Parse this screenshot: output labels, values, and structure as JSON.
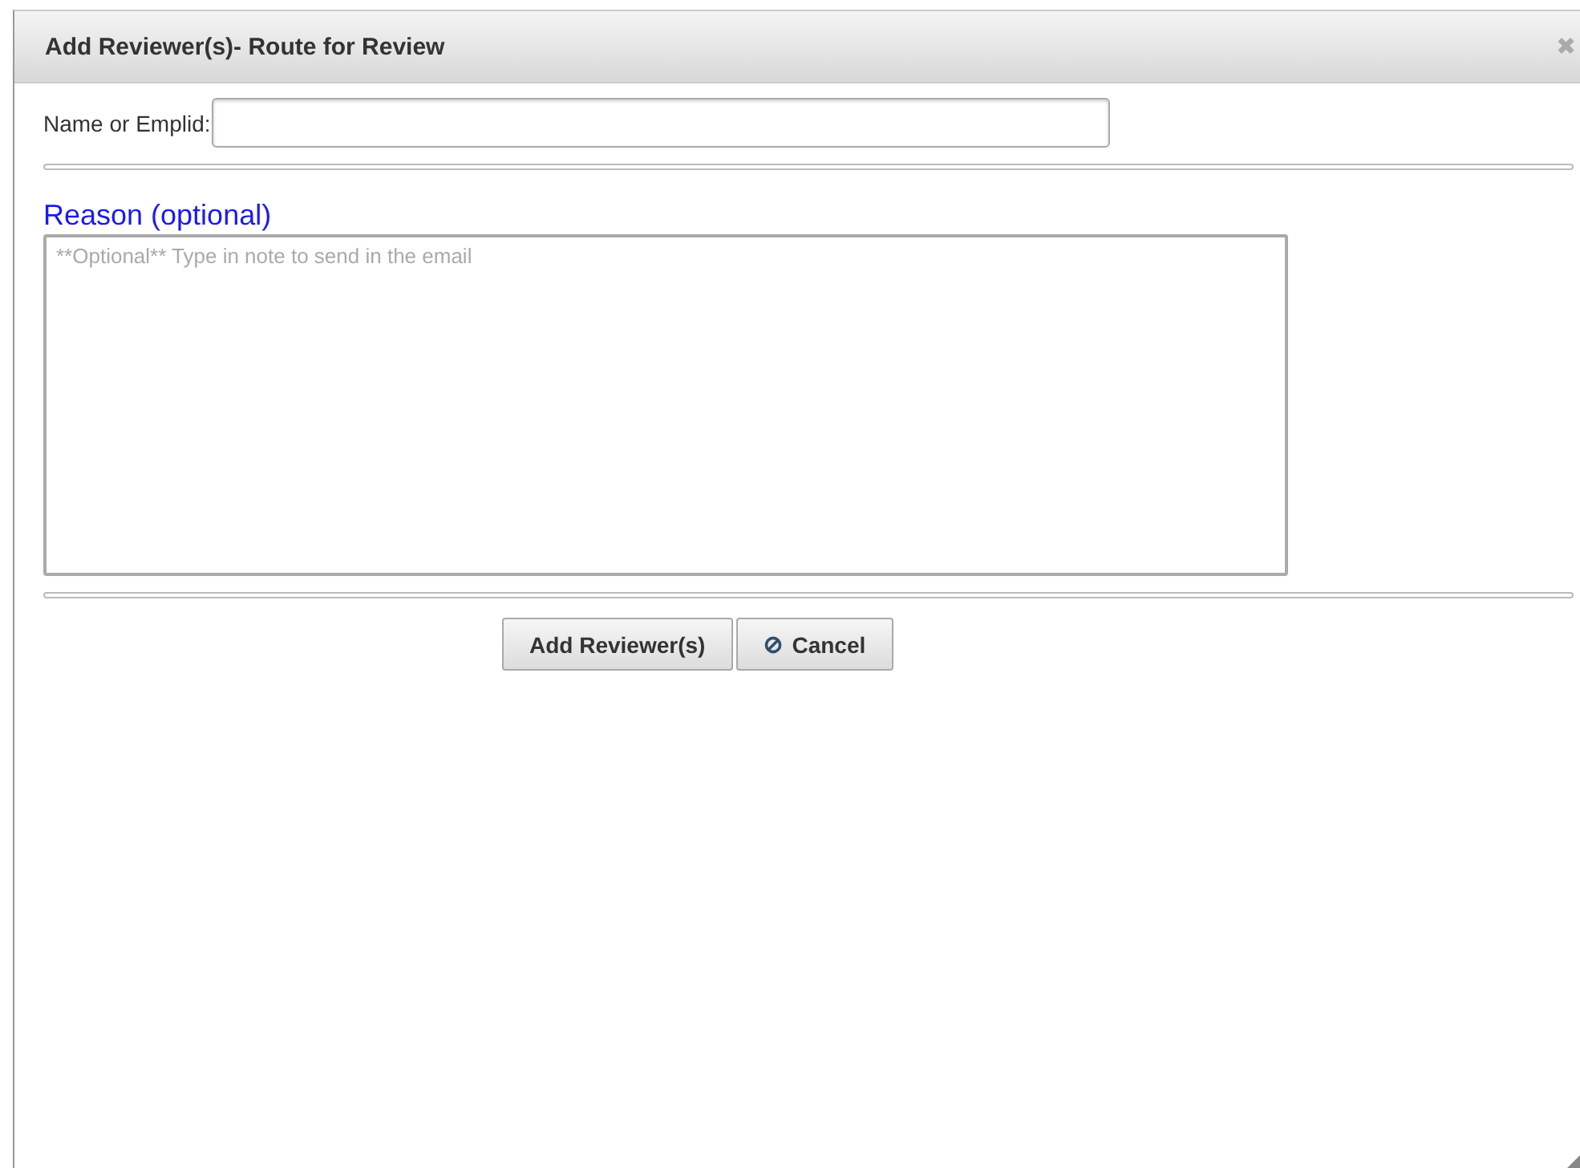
{
  "dialog": {
    "title": "Add Reviewer(s)- Route for Review",
    "close": "✖"
  },
  "name_field": {
    "label": "Name or Emplid:"
  },
  "reason": {
    "label": "Reason (optional)",
    "placeholder": "**Optional** Type in note to send in the email"
  },
  "buttons": [
    {
      "label": "Add Reviewer(s)",
      "kind": "plain"
    },
    {
      "label": "Cancel",
      "kind": "cancel"
    }
  ]
}
